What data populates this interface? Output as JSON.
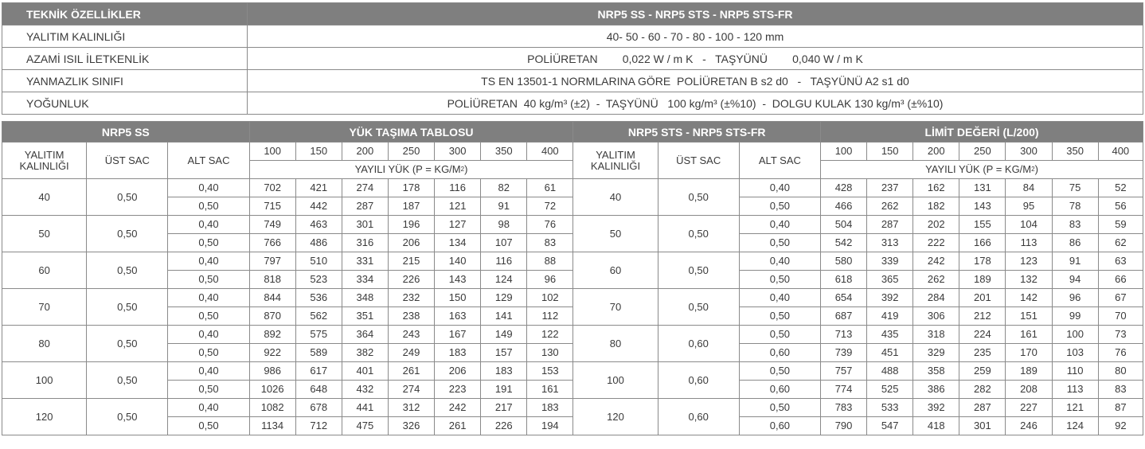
{
  "spec": {
    "header_key": "TEKNİK ÖZELLİKLER",
    "header_value": "NRP5 SS - NRP5 STS - NRP5 STS-FR",
    "rows": [
      {
        "key": "YALITIM KALINLIĞI",
        "value": "40- 50 - 60 - 70 - 80 - 100 - 120 mm"
      },
      {
        "key": "AZAMİ ISIL İLETKENLİK",
        "value": "POLİÜRETAN        0,022 W / m K   -   TAŞYÜNÜ        0,040 W / m K"
      },
      {
        "key": "YANMAZLIK SINIFI",
        "value": "TS EN 13501-1 NORMLARINA GÖRE  POLİÜRETAN B s2 d0   -   TAŞYÜNÜ A2 s1 d0"
      },
      {
        "key": "YOĞUNLUK",
        "value": "POLİÜRETAN  40 kg/m³ (±2)  -  TAŞYÜNÜ   100 kg/m³ (±%10)  -  DOLGU KULAK 130 kg/m³ (±%10)"
      }
    ]
  },
  "load": {
    "groups": [
      "NRP5 SS",
      "YÜK TAŞIMA TABLOSU",
      "NRP5 STS - NRP5 STS-FR",
      "LİMİT DEĞERİ (L/200)"
    ],
    "col_insulation": "YALITIM KALINLIĞI",
    "col_top": "ÜST SAC",
    "col_bottom": "ALT SAC",
    "spans": [
      "100",
      "150",
      "200",
      "250",
      "300",
      "350",
      "400"
    ],
    "distributed_load": "YAYILI YÜK (P = KG/M",
    "distributed_sup": "2",
    "distributed_close": ")",
    "rows": [
      {
        "t": "40",
        "top": "0,50",
        "alt": [
          "0,40",
          "0,50"
        ],
        "vals": [
          [
            "702",
            "421",
            "274",
            "178",
            "116",
            "82",
            "61"
          ],
          [
            "715",
            "442",
            "287",
            "187",
            "121",
            "91",
            "72"
          ]
        ],
        "t2": "40",
        "top2": "0,50",
        "alt2": [
          "0,40",
          "0,50"
        ],
        "vals2": [
          [
            "428",
            "237",
            "162",
            "131",
            "84",
            "75",
            "52"
          ],
          [
            "466",
            "262",
            "182",
            "143",
            "95",
            "78",
            "56"
          ]
        ]
      },
      {
        "t": "50",
        "top": "0,50",
        "alt": [
          "0,40",
          "0,50"
        ],
        "vals": [
          [
            "749",
            "463",
            "301",
            "196",
            "127",
            "98",
            "76"
          ],
          [
            "766",
            "486",
            "316",
            "206",
            "134",
            "107",
            "83"
          ]
        ],
        "t2": "50",
        "top2": "0,50",
        "alt2": [
          "0,40",
          "0,50"
        ],
        "vals2": [
          [
            "504",
            "287",
            "202",
            "155",
            "104",
            "83",
            "59"
          ],
          [
            "542",
            "313",
            "222",
            "166",
            "113",
            "86",
            "62"
          ]
        ]
      },
      {
        "t": "60",
        "top": "0,50",
        "alt": [
          "0,40",
          "0,50"
        ],
        "vals": [
          [
            "797",
            "510",
            "331",
            "215",
            "140",
            "116",
            "88"
          ],
          [
            "818",
            "523",
            "334",
            "226",
            "143",
            "124",
            "96"
          ]
        ],
        "t2": "60",
        "top2": "0,50",
        "alt2": [
          "0,40",
          "0,50"
        ],
        "vals2": [
          [
            "580",
            "339",
            "242",
            "178",
            "123",
            "91",
            "63"
          ],
          [
            "618",
            "365",
            "262",
            "189",
            "132",
            "94",
            "66"
          ]
        ]
      },
      {
        "t": "70",
        "top": "0,50",
        "alt": [
          "0,40",
          "0,50"
        ],
        "vals": [
          [
            "844",
            "536",
            "348",
            "232",
            "150",
            "129",
            "102"
          ],
          [
            "870",
            "562",
            "351",
            "238",
            "163",
            "141",
            "112"
          ]
        ],
        "t2": "70",
        "top2": "0,50",
        "alt2": [
          "0,40",
          "0,50"
        ],
        "vals2": [
          [
            "654",
            "392",
            "284",
            "201",
            "142",
            "96",
            "67"
          ],
          [
            "687",
            "419",
            "306",
            "212",
            "151",
            "99",
            "70"
          ]
        ]
      },
      {
        "t": "80",
        "top": "0,50",
        "alt": [
          "0,40",
          "0,50"
        ],
        "vals": [
          [
            "892",
            "575",
            "364",
            "243",
            "167",
            "149",
            "122"
          ],
          [
            "922",
            "589",
            "382",
            "249",
            "183",
            "157",
            "130"
          ]
        ],
        "t2": "80",
        "top2": "0,60",
        "alt2": [
          "0,50",
          "0,60"
        ],
        "vals2": [
          [
            "713",
            "435",
            "318",
            "224",
            "161",
            "100",
            "73"
          ],
          [
            "739",
            "451",
            "329",
            "235",
            "170",
            "103",
            "76"
          ]
        ]
      },
      {
        "t": "100",
        "top": "0,50",
        "alt": [
          "0,40",
          "0,50"
        ],
        "vals": [
          [
            "986",
            "617",
            "401",
            "261",
            "206",
            "183",
            "153"
          ],
          [
            "1026",
            "648",
            "432",
            "274",
            "223",
            "191",
            "161"
          ]
        ],
        "t2": "100",
        "top2": "0,60",
        "alt2": [
          "0,50",
          "0,60"
        ],
        "vals2": [
          [
            "757",
            "488",
            "358",
            "259",
            "189",
            "110",
            "80"
          ],
          [
            "774",
            "525",
            "386",
            "282",
            "208",
            "113",
            "83"
          ]
        ]
      },
      {
        "t": "120",
        "top": "0,50",
        "alt": [
          "0,40",
          "0,50"
        ],
        "vals": [
          [
            "1082",
            "678",
            "441",
            "312",
            "242",
            "217",
            "183"
          ],
          [
            "1134",
            "712",
            "475",
            "326",
            "261",
            "226",
            "194"
          ]
        ],
        "t2": "120",
        "top2": "0,60",
        "alt2": [
          "0,50",
          "0,60"
        ],
        "vals2": [
          [
            "783",
            "533",
            "392",
            "287",
            "227",
            "121",
            "87"
          ],
          [
            "790",
            "547",
            "418",
            "301",
            "246",
            "124",
            "92"
          ]
        ]
      }
    ]
  }
}
